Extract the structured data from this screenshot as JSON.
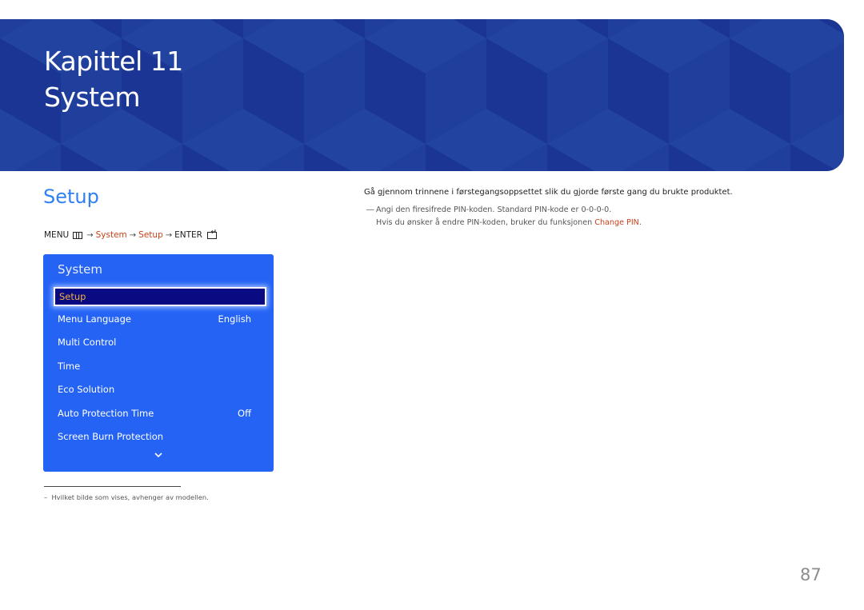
{
  "banner": {
    "chapter_label": "Kapittel 11",
    "chapter_name": "System",
    "background_color": "#1e3b9c"
  },
  "section": {
    "title": "Setup",
    "title_color": "#2f80f5"
  },
  "menu_path": {
    "menu_label": "MENU",
    "menu_icon": "menu-icon",
    "arrow": "→",
    "step1": "System",
    "step2": "Setup",
    "enter_label": "ENTER",
    "enter_icon": "enter-icon",
    "highlight_color": "#c8401a"
  },
  "osd": {
    "title": "System",
    "panel_color": "#2563f5",
    "selected_color": "#0a0a82",
    "items": [
      {
        "label": "Setup",
        "value": "",
        "selected": true
      },
      {
        "label": "Menu Language",
        "value": "English"
      },
      {
        "label": "Multi Control",
        "value": ""
      },
      {
        "label": "Time",
        "value": ""
      },
      {
        "label": "Eco Solution",
        "value": ""
      },
      {
        "label": "Auto Protection Time",
        "value": "Off"
      },
      {
        "label": "Screen Burn Protection",
        "value": ""
      }
    ],
    "more_icon": "chevron-down-icon"
  },
  "content": {
    "description": "Gå gjennom trinnene i førstegangsoppsettet slik du gjorde første gang du brukte produktet.",
    "note_dash": "―",
    "note_line1": "Angi den firesifrede PIN-koden. Standard PIN-kode er 0-0-0-0.",
    "note_line2_prefix": "Hvis du ønsker å endre PIN-koden, bruker du funksjonen ",
    "note_line2_link": "Change PIN",
    "note_line2_suffix": "."
  },
  "footnote": {
    "dash": "–",
    "text": "Hvilket bilde som vises, avhenger av modellen."
  },
  "page_number": "87"
}
